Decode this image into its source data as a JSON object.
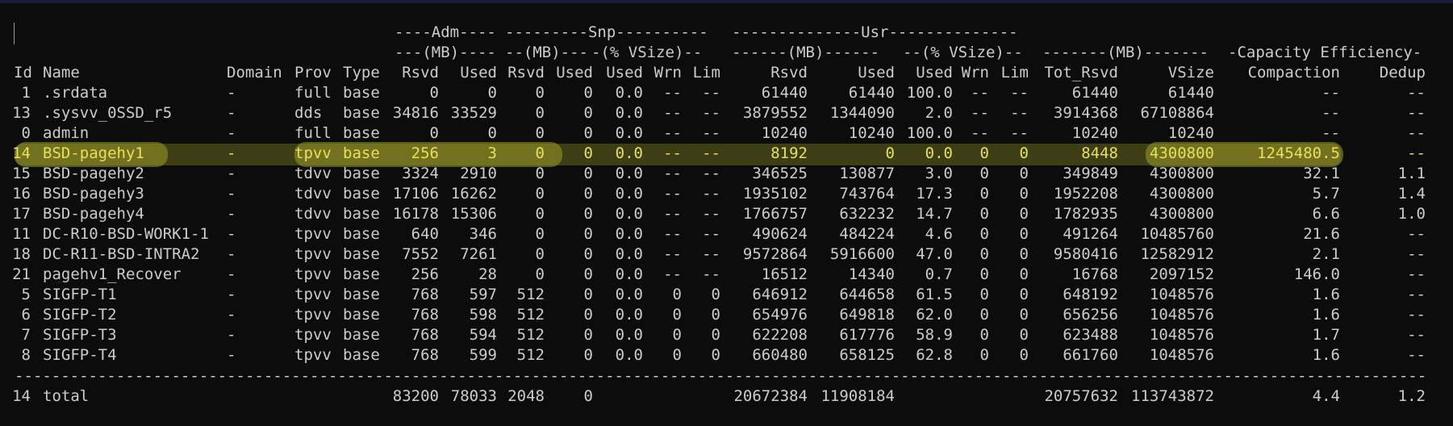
{
  "headers": {
    "group": [
      "----Adm----",
      "---------Snp----------",
      "--------------Usr--------------"
    ],
    "sub": [
      "---(MB)----",
      "--(MB)---",
      "-(% VSize)--",
      "------(MB)------",
      "--(% VSize)--",
      "-------(MB)-------",
      "-Capacity Efficiency-"
    ],
    "columns": [
      "Id",
      "Name",
      "Domain",
      "Prov",
      "Type",
      "Rsvd",
      "Used",
      "Rsvd",
      "Used",
      "Used",
      "Wrn",
      "Lim",
      "Rsvd",
      "Used",
      "Used",
      "Wrn",
      "Lim",
      "Tot_Rsvd",
      "VSize",
      "Compaction",
      "Dedup"
    ]
  },
  "rows": [
    [
      "1",
      ".srdata",
      "-",
      "full",
      "base",
      "0",
      "0",
      "0",
      "0",
      "0.0",
      "--",
      "--",
      "61440",
      "61440",
      "100.0",
      "--",
      "--",
      "61440",
      "61440",
      "--",
      "--"
    ],
    [
      "13",
      ".sysvv_0SSD_r5",
      "-",
      "dds",
      "base",
      "34816",
      "33529",
      "0",
      "0",
      "0.0",
      "--",
      "--",
      "3879552",
      "1344090",
      "2.0",
      "--",
      "--",
      "3914368",
      "67108864",
      "--",
      "--"
    ],
    [
      "0",
      "admin",
      "-",
      "full",
      "base",
      "0",
      "0",
      "0",
      "0",
      "0.0",
      "--",
      "--",
      "10240",
      "10240",
      "100.0",
      "--",
      "--",
      "10240",
      "10240",
      "--",
      "--"
    ],
    [
      "14",
      "BSD-pagehy1",
      "-",
      "tpvv",
      "base",
      "256",
      "3",
      "0",
      "0",
      "0.0",
      "--",
      "--",
      "8192",
      "0",
      "0.0",
      "0",
      "0",
      "8448",
      "4300800",
      "1245480.5",
      "--"
    ],
    [
      "15",
      "BSD-pagehy2",
      "-",
      "tdvv",
      "base",
      "3324",
      "2910",
      "0",
      "0",
      "0.0",
      "--",
      "--",
      "346525",
      "130877",
      "3.0",
      "0",
      "0",
      "349849",
      "4300800",
      "32.1",
      "1.1"
    ],
    [
      "16",
      "BSD-pagehy3",
      "-",
      "tdvv",
      "base",
      "17106",
      "16262",
      "0",
      "0",
      "0.0",
      "--",
      "--",
      "1935102",
      "743764",
      "17.3",
      "0",
      "0",
      "1952208",
      "4300800",
      "5.7",
      "1.4"
    ],
    [
      "17",
      "BSD-pagehy4",
      "-",
      "tdvv",
      "base",
      "16178",
      "15306",
      "0",
      "0",
      "0.0",
      "--",
      "--",
      "1766757",
      "632232",
      "14.7",
      "0",
      "0",
      "1782935",
      "4300800",
      "6.6",
      "1.0"
    ],
    [
      "11",
      "DC-R10-BSD-WORK1-1",
      "-",
      "tpvv",
      "base",
      "640",
      "346",
      "0",
      "0",
      "0.0",
      "--",
      "--",
      "490624",
      "484224",
      "4.6",
      "0",
      "0",
      "491264",
      "10485760",
      "21.6",
      "--"
    ],
    [
      "18",
      "DC-R11-BSD-INTRA2",
      "-",
      "tpvv",
      "base",
      "7552",
      "7261",
      "0",
      "0",
      "0.0",
      "--",
      "--",
      "9572864",
      "5916600",
      "47.0",
      "0",
      "0",
      "9580416",
      "12582912",
      "2.1",
      "--"
    ],
    [
      "21",
      "pagehv1_Recover",
      "-",
      "tpvv",
      "base",
      "256",
      "28",
      "0",
      "0",
      "0.0",
      "--",
      "--",
      "16512",
      "14340",
      "0.7",
      "0",
      "0",
      "16768",
      "2097152",
      "146.0",
      "--"
    ],
    [
      "5",
      "SIGFP-T1",
      "-",
      "tpvv",
      "base",
      "768",
      "597",
      "512",
      "0",
      "0.0",
      "0",
      "0",
      "646912",
      "644658",
      "61.5",
      "0",
      "0",
      "648192",
      "1048576",
      "1.6",
      "--"
    ],
    [
      "6",
      "SIGFP-T2",
      "-",
      "tpvv",
      "base",
      "768",
      "598",
      "512",
      "0",
      "0.0",
      "0",
      "0",
      "654976",
      "649818",
      "62.0",
      "0",
      "0",
      "656256",
      "1048576",
      "1.6",
      "--"
    ],
    [
      "7",
      "SIGFP-T3",
      "-",
      "tpvv",
      "base",
      "768",
      "594",
      "512",
      "0",
      "0.0",
      "0",
      "0",
      "622208",
      "617776",
      "58.9",
      "0",
      "0",
      "623488",
      "1048576",
      "1.7",
      "--"
    ],
    [
      "8",
      "SIGFP-T4",
      "-",
      "tpvv",
      "base",
      "768",
      "599",
      "512",
      "0",
      "0.0",
      "0",
      "0",
      "660480",
      "658125",
      "62.8",
      "0",
      "0",
      "661760",
      "1048576",
      "1.6",
      "--"
    ]
  ],
  "divider": "---------------------------------------------------------------------------------------------------------------------------------------------------------------",
  "total": [
    "14",
    "total",
    "",
    "",
    "",
    "83200",
    "78033",
    "2048",
    "0",
    "",
    "",
    "",
    "20672384",
    "11908184",
    "",
    "",
    "",
    "20757632",
    "113743872",
    "4.4",
    "1.2"
  ],
  "highlighted_row_index": 3,
  "colors": {
    "background": "#0c0c0c",
    "text": "#cccccc",
    "highlight_text": "#e8e05a",
    "highlight_marker": "#7d7d23"
  }
}
